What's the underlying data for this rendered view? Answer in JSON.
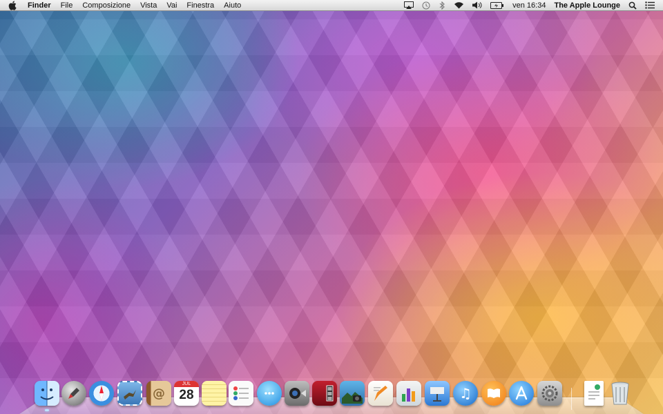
{
  "menubar": {
    "app_name": "Finder",
    "menus": [
      "File",
      "Composizione",
      "Vista",
      "Vai",
      "Finestra",
      "Aiuto"
    ],
    "status": {
      "clock": "ven 16:34",
      "user": "The Apple Lounge"
    },
    "status_icons": [
      "airplay-icon",
      "time-machine-icon",
      "bluetooth-icon",
      "wifi-icon",
      "volume-icon",
      "battery-icon",
      "spotlight-icon",
      "notification-center-icon"
    ]
  },
  "dock": {
    "calendar_day": "28",
    "calendar_month": "JUL",
    "apps": [
      {
        "name": "finder",
        "running": true
      },
      {
        "name": "launchpad",
        "running": false
      },
      {
        "name": "safari",
        "running": false
      },
      {
        "name": "mail",
        "running": false
      },
      {
        "name": "contacts",
        "running": false
      },
      {
        "name": "calendar",
        "running": false
      },
      {
        "name": "notes",
        "running": false
      },
      {
        "name": "reminders",
        "running": false
      },
      {
        "name": "messages",
        "running": false
      },
      {
        "name": "facetime",
        "running": false
      },
      {
        "name": "photo-booth",
        "running": false
      },
      {
        "name": "iphoto",
        "running": false
      },
      {
        "name": "pages",
        "running": false
      },
      {
        "name": "numbers",
        "running": false
      },
      {
        "name": "keynote",
        "running": false
      },
      {
        "name": "itunes",
        "running": false
      },
      {
        "name": "ibooks",
        "running": false
      },
      {
        "name": "app-store",
        "running": false
      },
      {
        "name": "system-preferences",
        "running": false
      },
      {
        "name": "preview-document",
        "running": false
      },
      {
        "name": "trash",
        "running": false
      }
    ]
  },
  "colors": {
    "menubar": "#e6e6e6",
    "accent_blue": "#1e7be0"
  }
}
